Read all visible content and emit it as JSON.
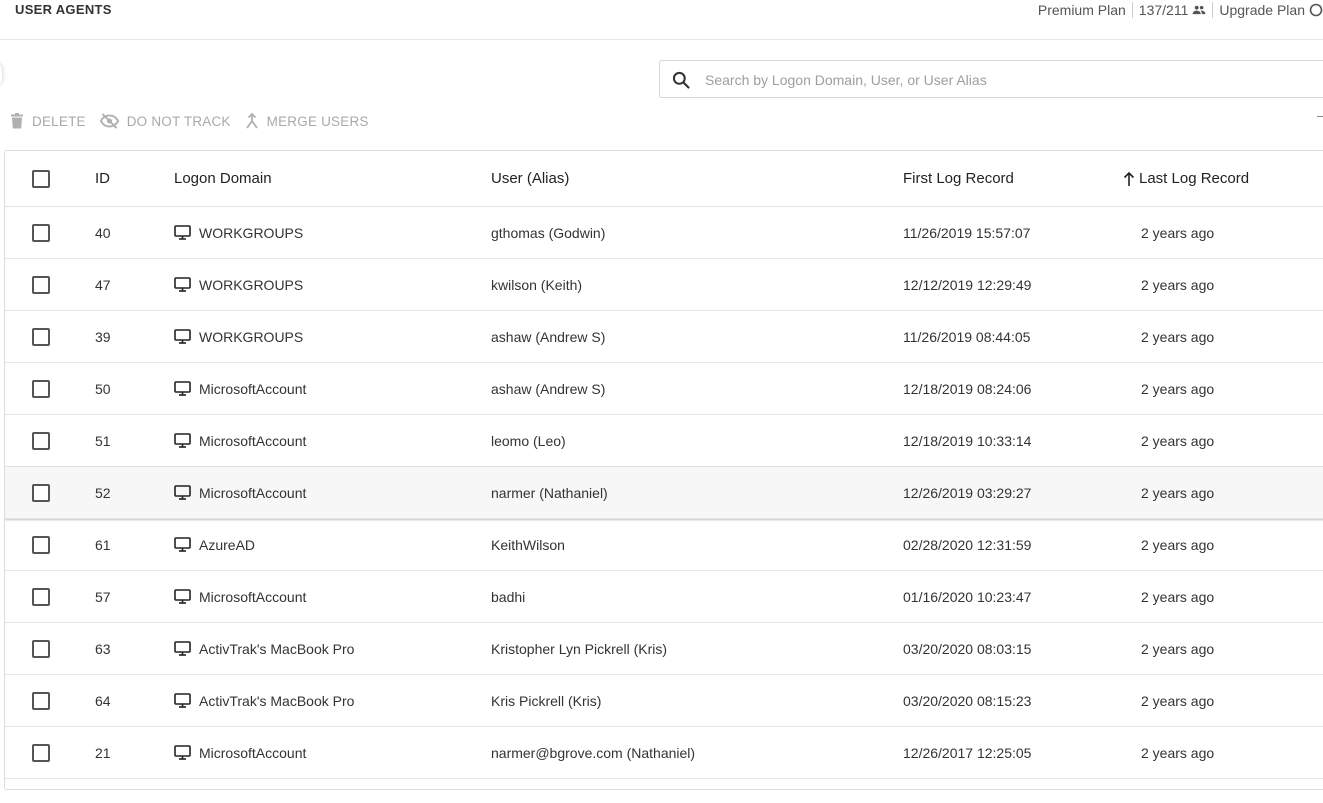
{
  "header": {
    "title": "USER AGENTS",
    "plan": "Premium Plan",
    "user_count": "137/211",
    "upgrade": "Upgrade Plan"
  },
  "search": {
    "placeholder": "Search by Logon Domain, User, or User Alias",
    "value": ""
  },
  "toolbar": {
    "delete_label": "DELETE",
    "do_not_track_label": "DO NOT TRACK",
    "merge_users_label": "MERGE USERS"
  },
  "table": {
    "columns": {
      "id": "ID",
      "logon_domain": "Logon Domain",
      "user": "User (Alias)",
      "first_log": "First Log Record",
      "last_log": "Last Log Record"
    },
    "sort_column": "last_log",
    "hover_row": 5,
    "rows": [
      {
        "id": "40",
        "domain": "WORKGROUPS",
        "user": "gthomas (Godwin)",
        "first": "11/26/2019 15:57:07",
        "last": "2 years ago"
      },
      {
        "id": "47",
        "domain": "WORKGROUPS",
        "user": "kwilson (Keith)",
        "first": "12/12/2019 12:29:49",
        "last": "2 years ago"
      },
      {
        "id": "39",
        "domain": "WORKGROUPS",
        "user": "ashaw (Andrew S)",
        "first": "11/26/2019 08:44:05",
        "last": "2 years ago"
      },
      {
        "id": "50",
        "domain": "MicrosoftAccount",
        "user": "ashaw (Andrew S)",
        "first": "12/18/2019 08:24:06",
        "last": "2 years ago"
      },
      {
        "id": "51",
        "domain": "MicrosoftAccount",
        "user": "leomo (Leo)",
        "first": "12/18/2019 10:33:14",
        "last": "2 years ago"
      },
      {
        "id": "52",
        "domain": "MicrosoftAccount",
        "user": "narmer (Nathaniel)",
        "first": "12/26/2019 03:29:27",
        "last": "2 years ago"
      },
      {
        "id": "61",
        "domain": "AzureAD",
        "user": "KeithWilson",
        "first": "02/28/2020 12:31:59",
        "last": "2 years ago"
      },
      {
        "id": "57",
        "domain": "MicrosoftAccount",
        "user": "badhi",
        "first": "01/16/2020 10:23:47",
        "last": "2 years ago"
      },
      {
        "id": "63",
        "domain": "ActivTrak's MacBook Pro",
        "user": "Kristopher Lyn Pickrell (Kris)",
        "first": "03/20/2020 08:03:15",
        "last": "2 years ago"
      },
      {
        "id": "64",
        "domain": "ActivTrak's MacBook Pro",
        "user": "Kris Pickrell (Kris)",
        "first": "03/20/2020 08:15:23",
        "last": "2 years ago"
      },
      {
        "id": "21",
        "domain": "MicrosoftAccount",
        "user": "narmer@bgrove.com (Nathaniel)",
        "first": "12/26/2017 12:25:05",
        "last": "2 years ago"
      }
    ]
  }
}
